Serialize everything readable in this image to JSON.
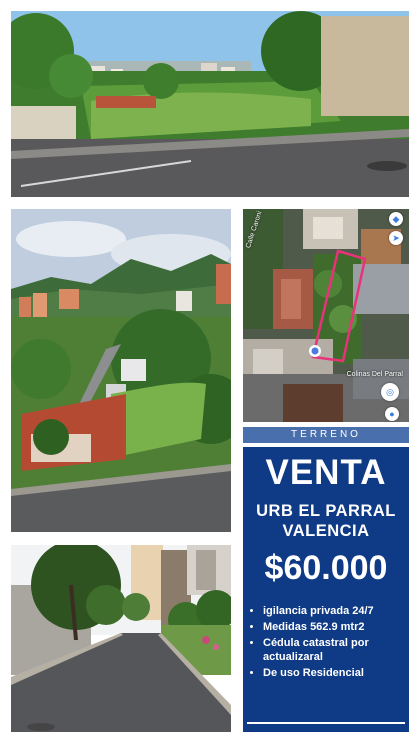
{
  "listing": {
    "category": "TERRENO",
    "headline": "VENTA",
    "location_line1": "URB EL PARRAL",
    "location_line2": "VALENCIA",
    "price": "$60.000",
    "features": [
      "igilancia privada 24/7",
      "Medidas 562.9 mtr2",
      "Cédula catastral por actualizaral",
      "De uso Residencial"
    ]
  },
  "map": {
    "street_label": "Calle Caroni",
    "place_label": "Colinas Del Parral"
  },
  "colors": {
    "panel_background": "#0f3a86",
    "header_background": "#4a6fad",
    "plot_outline": "#e8327a",
    "text": "#ffffff"
  },
  "icons": {
    "map_layers": "layers-icon",
    "map_location": "my-location-icon",
    "map_pin": "map-pin-icon"
  }
}
